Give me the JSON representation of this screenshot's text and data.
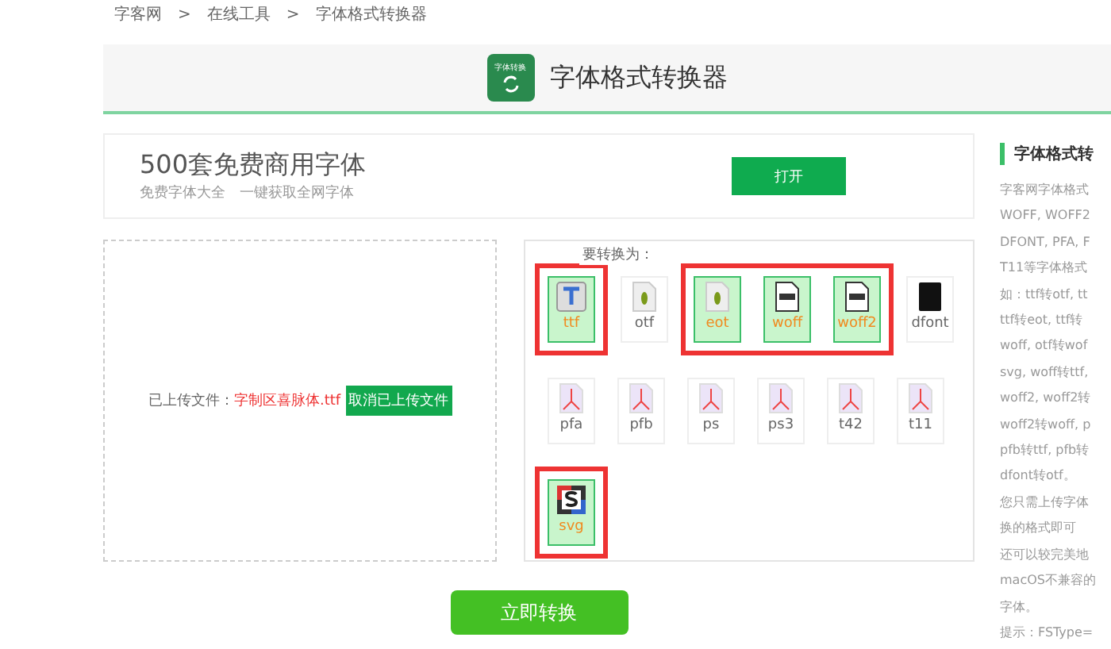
{
  "breadcrumb": [
    "字客网",
    "在线工具",
    "字体格式转换器"
  ],
  "breadcrumb_separator": ">",
  "header": {
    "logo_text": "字体转换",
    "title": "字体格式转换器"
  },
  "promo": {
    "title": "500套免费商用字体",
    "subtitle": "免费字体大全　一键获取全网字体",
    "button": "打开"
  },
  "upload": {
    "label": "已上传文件：",
    "file_name": "字制区喜脉体.ttf",
    "cancel_button": "取消已上传文件"
  },
  "formats": {
    "label": "要转换为：",
    "rows": [
      [
        {
          "annotated": true,
          "items": [
            {
              "label": "ttf",
              "kind": "truetype",
              "selected": true
            }
          ]
        },
        {
          "annotated": false,
          "items": [
            {
              "label": "otf",
              "kind": "opentype",
              "selected": false
            }
          ]
        },
        {
          "annotated": true,
          "items": [
            {
              "label": "eot",
              "kind": "opentype",
              "selected": true
            },
            {
              "label": "woff",
              "kind": "woff",
              "selected": true
            },
            {
              "label": "woff2",
              "kind": "woff",
              "selected": true
            }
          ]
        },
        {
          "annotated": false,
          "items": [
            {
              "label": "dfont",
              "kind": "dark",
              "selected": false
            }
          ]
        }
      ],
      [
        {
          "annotated": false,
          "items": [
            {
              "label": "pfa",
              "kind": "pdf",
              "selected": false
            },
            {
              "label": "pfb",
              "kind": "pdf",
              "selected": false
            },
            {
              "label": "ps",
              "kind": "pdf",
              "selected": false
            },
            {
              "label": "ps3",
              "kind": "pdf",
              "selected": false
            },
            {
              "label": "t42",
              "kind": "pdf",
              "selected": false
            },
            {
              "label": "t11",
              "kind": "pdf",
              "selected": false
            }
          ]
        }
      ],
      [
        {
          "annotated": true,
          "items": [
            {
              "label": "svg",
              "kind": "svg",
              "selected": true
            }
          ]
        }
      ]
    ]
  },
  "convert_button": "立即转换",
  "sidebar": {
    "title": "字体格式转",
    "lines": [
      "字客网字体格式",
      "WOFF, WOFF2",
      "DFONT, PFA, F",
      "T11等字体格式",
      "如：ttf转otf, tt",
      "ttf转eot, ttf转",
      "woff, otf转wof",
      "svg, woff转ttf,",
      "woff2, woff2转",
      "woff2转woff, p",
      "pfb转ttf, pfb转",
      "dfont转otf。",
      "您只需上传字体",
      "换的格式即可",
      "还可以较完美地",
      "macOS不兼容的",
      "字体。",
      "提示：FSType="
    ]
  }
}
